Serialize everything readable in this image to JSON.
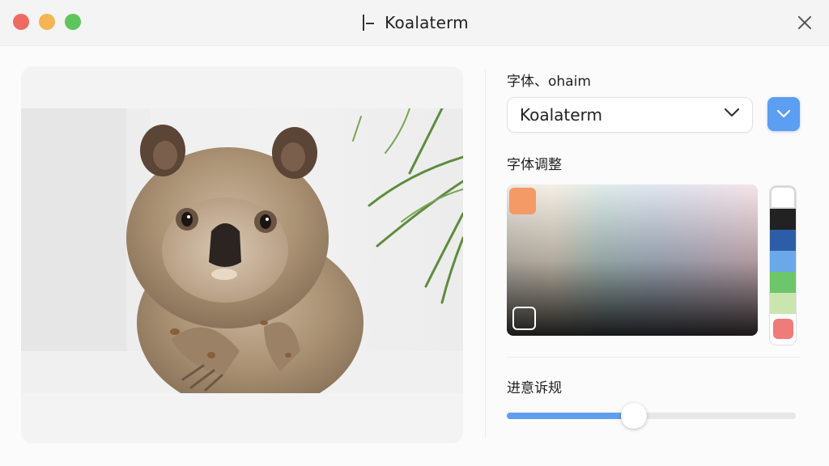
{
  "window": {
    "title": "Koalaterm"
  },
  "font_section": {
    "label": "字体、ohaim",
    "select_value": "Koalaterm"
  },
  "adjust_section": {
    "label": "字体调整",
    "selected_swatch": "#f39a66",
    "palette": [
      "#ffffff",
      "#222222",
      "#2d5da6",
      "#6aa8ea",
      "#6dc669",
      "#cbe5b1",
      "#ee7c79"
    ]
  },
  "progress_section": {
    "label": "进意诉规",
    "slider_value": 0.44
  },
  "colors": {
    "accent": "#5b9ef2",
    "close_red": "#ee6b63",
    "minimize_yellow": "#f4b553",
    "zoom_green": "#5dc65a"
  }
}
